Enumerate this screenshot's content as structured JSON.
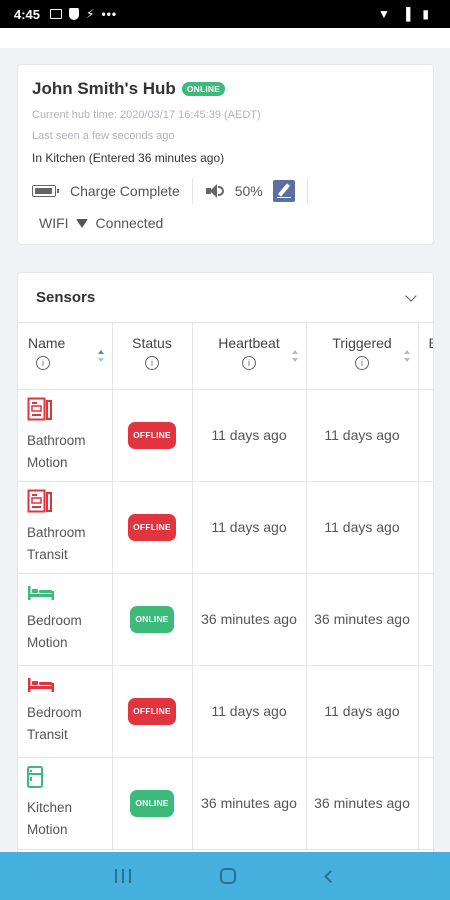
{
  "status_bar": {
    "time": "4:45",
    "icons_left": [
      "image-icon",
      "shield-icon",
      "notification-icon",
      "more-icon"
    ],
    "icons_right": [
      "wifi-icon",
      "signal-icon",
      "battery-icon"
    ],
    "more": "•••"
  },
  "hub": {
    "title": "John Smith's Hub",
    "status": "ONLINE",
    "hub_time": "Current hub time: 2020/03/17 16:45:39 (AEDT)",
    "last_seen": "Last seen a few seconds ago",
    "location": "In Kitchen (Entered 36 minutes ago)",
    "charge": "Charge Complete",
    "volume": "50%",
    "network_label": "WIFI",
    "network_status": "Connected"
  },
  "sensors": {
    "title": "Sensors",
    "columns": [
      "Name",
      "Status",
      "Heartbeat",
      "Triggered",
      "B"
    ],
    "rows": [
      {
        "name": "Bathroom Motion",
        "icon": "bath-icon",
        "icon_color": "#e0353e",
        "status": "OFFLINE",
        "heartbeat": "11 days ago",
        "triggered": "11 days ago"
      },
      {
        "name": "Bathroom Transit",
        "icon": "bath-icon",
        "icon_color": "#e0353e",
        "status": "OFFLINE",
        "heartbeat": "11 days ago",
        "triggered": "11 days ago"
      },
      {
        "name": "Bedroom Motion",
        "icon": "bed-icon",
        "icon_color": "#3cba7a",
        "status": "ONLINE",
        "heartbeat": "36 minutes ago",
        "triggered": "36 minutes ago"
      },
      {
        "name": "Bedroom Transit",
        "icon": "bed-icon",
        "icon_color": "#e0353e",
        "status": "OFFLINE",
        "heartbeat": "11 days ago",
        "triggered": "11 days ago"
      },
      {
        "name": "Kitchen Motion",
        "icon": "kitchen-icon",
        "icon_color": "#3cba7a",
        "status": "ONLINE",
        "heartbeat": "36 minutes ago",
        "triggered": "36 minutes ago"
      }
    ]
  },
  "colors": {
    "online": "#3cba7a",
    "offline": "#e0353e",
    "navbar": "#45b0de",
    "edit_button": "#5b6fa1"
  }
}
